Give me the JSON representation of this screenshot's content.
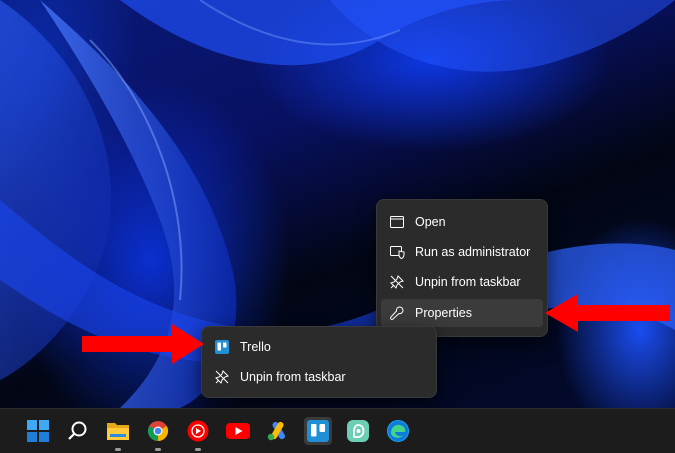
{
  "context_menu": {
    "items": [
      {
        "label": "Open",
        "icon": "window-icon"
      },
      {
        "label": "Run as administrator",
        "icon": "shield-icon"
      },
      {
        "label": "Unpin from taskbar",
        "icon": "unpin-icon"
      },
      {
        "label": "Properties",
        "icon": "wrench-icon"
      }
    ]
  },
  "jump_list": {
    "items": [
      {
        "label": "Trello",
        "icon": "trello-icon"
      },
      {
        "label": "Unpin from taskbar",
        "icon": "unpin-icon"
      }
    ]
  },
  "taskbar": {
    "icons": [
      "windows-start-icon",
      "search-icon",
      "file-explorer-icon",
      "chrome-icon",
      "youtube-music-icon",
      "youtube-icon",
      "google-ads-icon",
      "trello-icon",
      "app-icon",
      "edge-icon"
    ]
  },
  "colors": {
    "accent_arrow": "#ff0000",
    "menu_bg": "#2b2b2b",
    "taskbar_bg": "#1c1c1c"
  }
}
